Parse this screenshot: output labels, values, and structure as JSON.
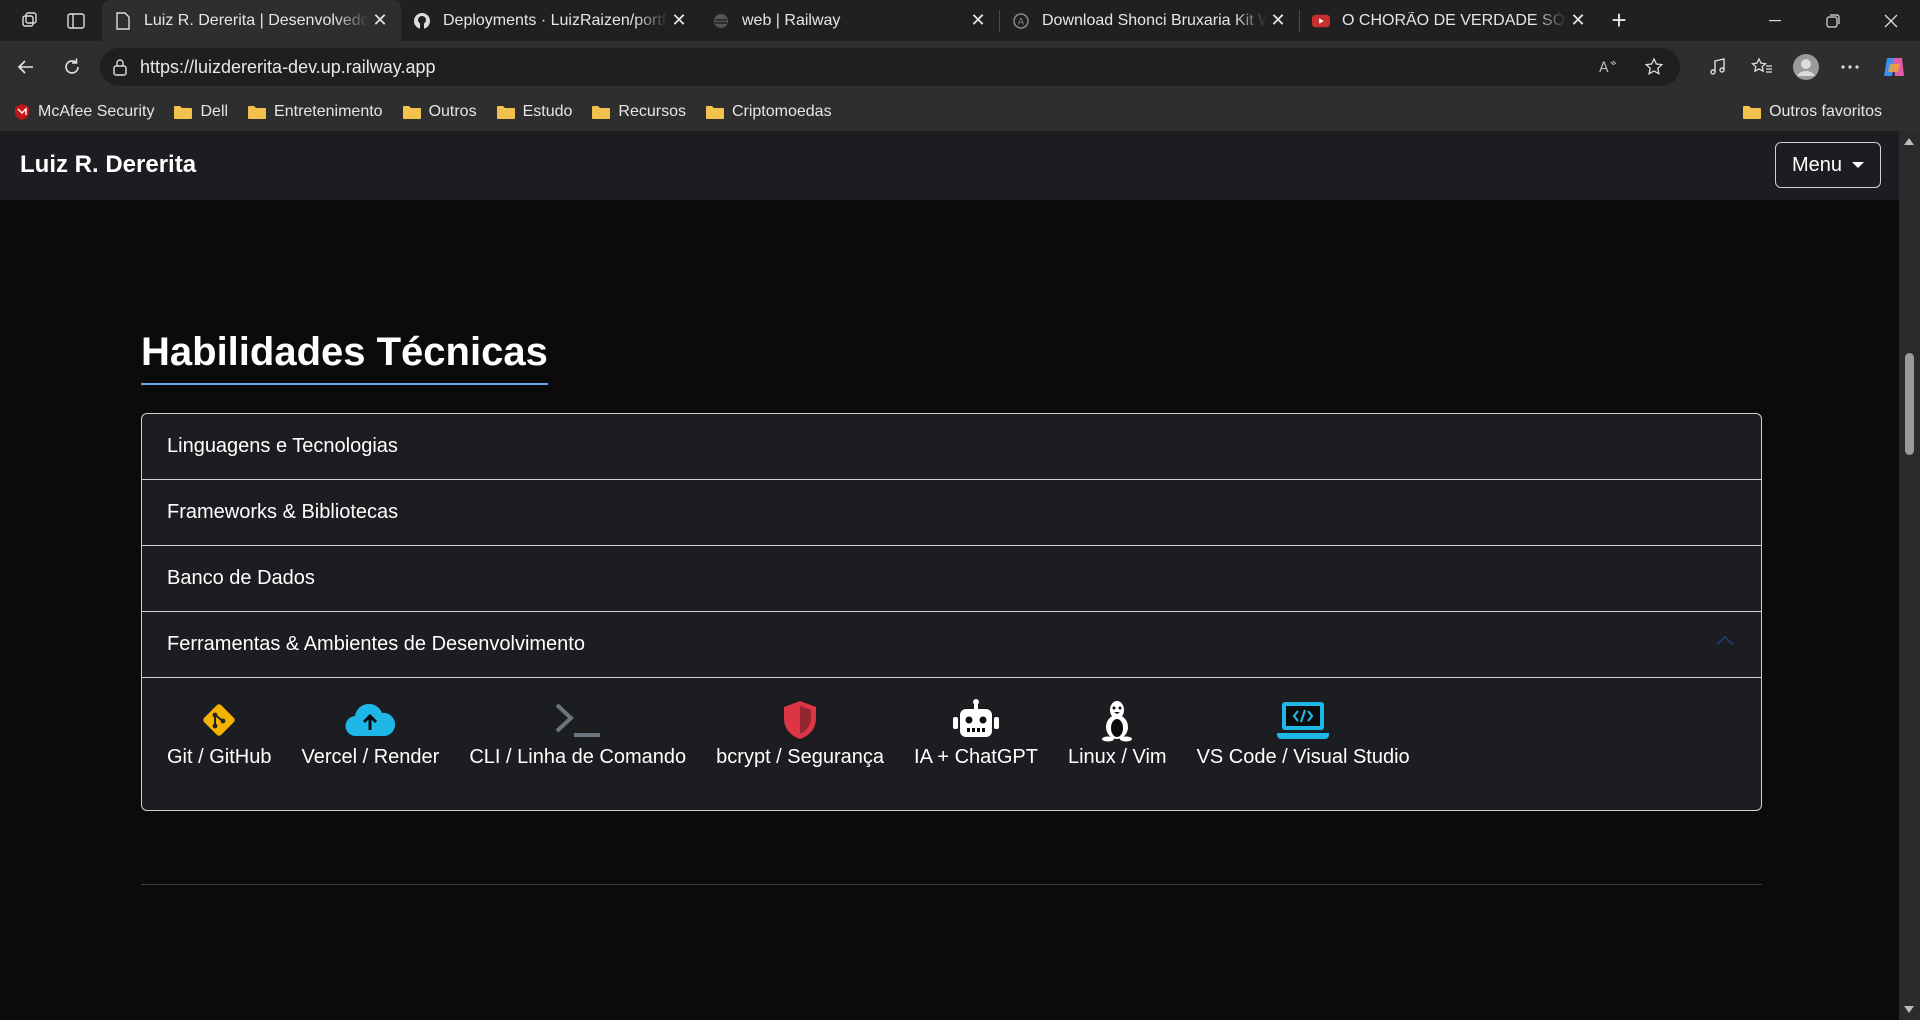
{
  "browser": {
    "tabs": [
      {
        "title": "Luiz R. Dererita | Desenvolvedor F",
        "icon": "page-icon",
        "active": true
      },
      {
        "title": "Deployments · LuizRaizen/portfoli",
        "icon": "github-icon",
        "active": false
      },
      {
        "title": "web | Railway",
        "icon": "railway-icon",
        "active": false
      },
      {
        "title": "Download Shonci Bruxaria Kit WA",
        "icon": "site-icon",
        "active": false
      },
      {
        "title": "O CHORÃO DE VERDADE SÓ QUE",
        "icon": "youtube-icon",
        "active": false
      }
    ],
    "url": "https://luizdererita-dev.up.railway.app",
    "bookmarks": [
      {
        "label": "McAfee Security",
        "icon": "mcafee-icon"
      },
      {
        "label": "Dell",
        "icon": "folder-icon"
      },
      {
        "label": "Entretenimento",
        "icon": "folder-icon"
      },
      {
        "label": "Outros",
        "icon": "folder-icon"
      },
      {
        "label": "Estudo",
        "icon": "folder-icon"
      },
      {
        "label": "Recursos",
        "icon": "folder-icon"
      },
      {
        "label": "Criptomoedas",
        "icon": "folder-icon"
      }
    ],
    "other_favorites": "Outros favoritos"
  },
  "site": {
    "brand": "Luiz R. Dererita",
    "menu_label": "Menu",
    "section_title": "Habilidades Técnicas",
    "accordion": [
      {
        "label": "Linguagens e Tecnologias",
        "expanded": false
      },
      {
        "label": "Frameworks & Bibliotecas",
        "expanded": false
      },
      {
        "label": "Banco de Dados",
        "expanded": false
      },
      {
        "label": "Ferramentas & Ambientes de Desenvolvimento",
        "expanded": true
      }
    ],
    "tools": [
      {
        "label": "Git / GitHub",
        "icon": "git-icon",
        "color": "#f5b301"
      },
      {
        "label": "Vercel / Render",
        "icon": "cloud-upload-icon",
        "color": "#1fb6e8"
      },
      {
        "label": "CLI / Linha de Comando",
        "icon": "terminal-icon",
        "color": "#6c757d"
      },
      {
        "label": "bcrypt / Segurança",
        "icon": "shield-icon",
        "color": "#dc3545"
      },
      {
        "label": "IA + ChatGPT",
        "icon": "robot-icon",
        "color": "#ffffff"
      },
      {
        "label": "Linux / Vim",
        "icon": "linux-icon",
        "color": "#ffffff"
      },
      {
        "label": "VS Code / Visual Studio",
        "icon": "laptop-code-icon",
        "color": "#1fb6e8"
      }
    ]
  }
}
